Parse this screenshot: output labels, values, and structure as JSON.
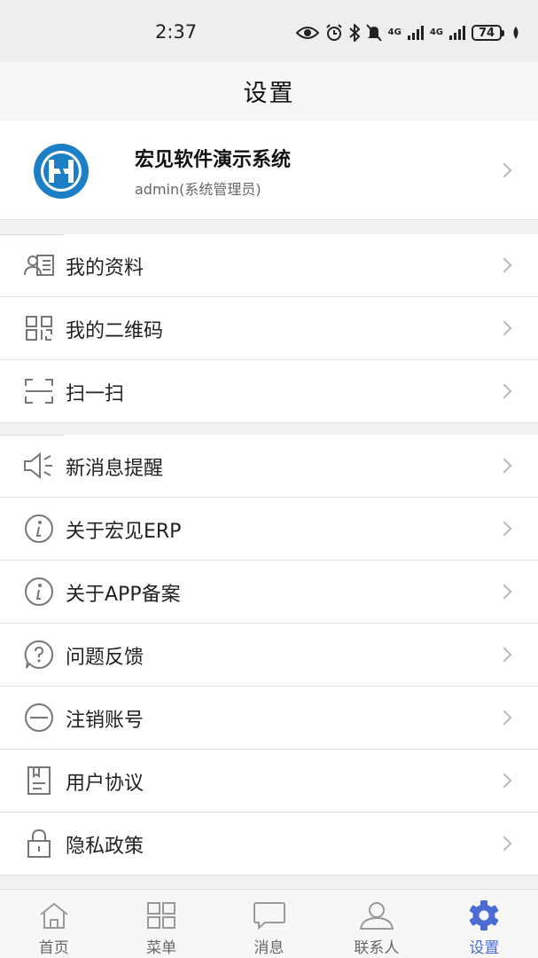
{
  "status_bar": {
    "time": "2:37",
    "network_1": "4G",
    "network_2": "4G",
    "battery": "74",
    "icons": [
      "eye-icon",
      "alarm-icon",
      "bluetooth-icon",
      "mute-icon",
      "signal-icon",
      "signal-icon",
      "battery-icon",
      "leaf-icon"
    ]
  },
  "header": {
    "title": "设置"
  },
  "profile": {
    "name": "宏见软件演示系统",
    "subtitle": "admin(系统管理员)",
    "logo_color": "#1a7fc4"
  },
  "groups": [
    {
      "items": [
        {
          "label": "我的资料",
          "icon": "id-card-icon"
        },
        {
          "label": "我的二维码",
          "icon": "qr-code-icon"
        },
        {
          "label": "扫一扫",
          "icon": "scan-icon"
        }
      ]
    },
    {
      "items": [
        {
          "label": "新消息提醒",
          "icon": "speaker-icon"
        },
        {
          "label": "关于宏见ERP",
          "icon": "info-icon"
        },
        {
          "label": "关于APP备案",
          "icon": "info-icon"
        },
        {
          "label": "问题反馈",
          "icon": "question-icon"
        },
        {
          "label": "注销账号",
          "icon": "minus-circle-icon"
        },
        {
          "label": "用户协议",
          "icon": "document-icon"
        },
        {
          "label": "隐私政策",
          "icon": "lock-icon"
        }
      ]
    }
  ],
  "bottom_nav": {
    "active_color": "#4a6cd4",
    "items": [
      {
        "label": "首页",
        "icon": "home-icon",
        "active": false
      },
      {
        "label": "菜单",
        "icon": "grid-icon",
        "active": false
      },
      {
        "label": "消息",
        "icon": "chat-icon",
        "active": false
      },
      {
        "label": "联系人",
        "icon": "contact-icon",
        "active": false
      },
      {
        "label": "设置",
        "icon": "gear-icon",
        "active": true
      }
    ]
  }
}
